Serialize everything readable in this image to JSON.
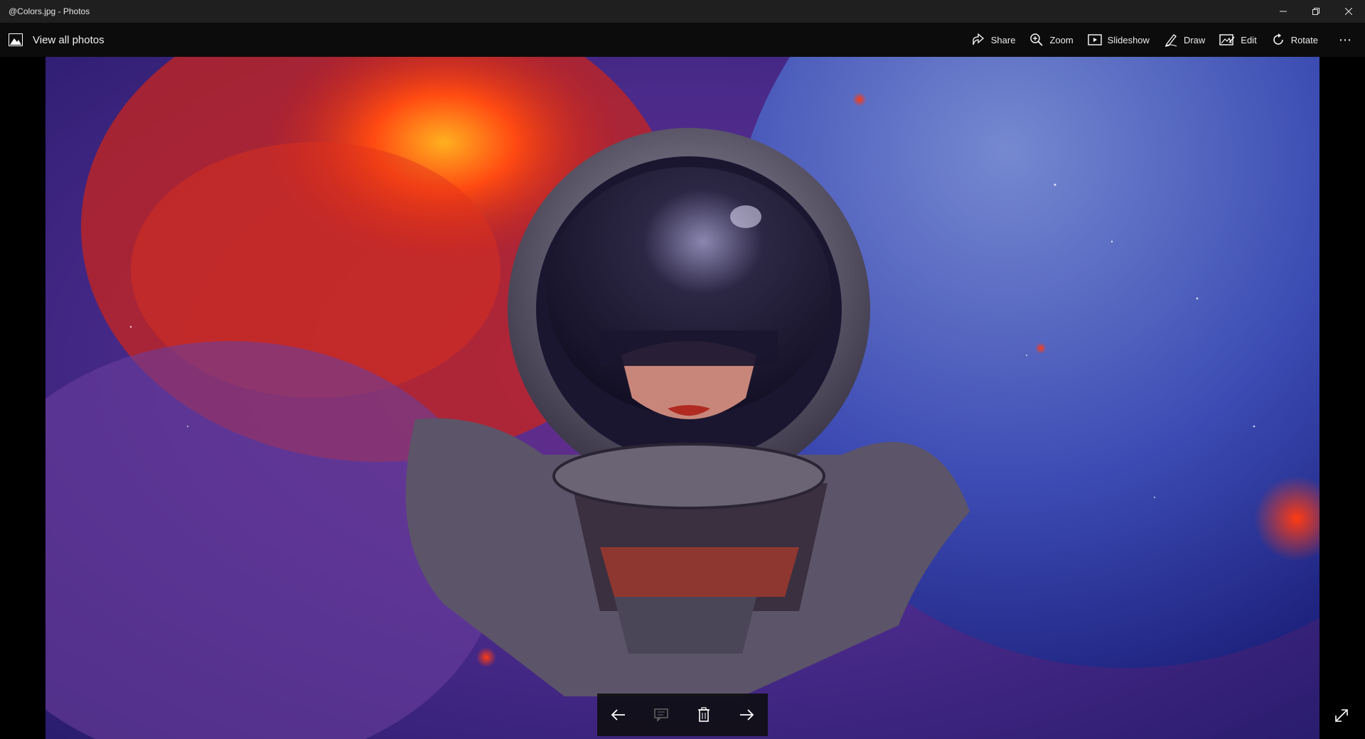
{
  "window": {
    "title": "@Colors.jpg - Photos",
    "controls": [
      "minimize",
      "restore",
      "close"
    ]
  },
  "toolbar": {
    "view_all_label": "View all photos",
    "commands": [
      {
        "label": "Share",
        "icon": "share-icon"
      },
      {
        "label": "Zoom",
        "icon": "zoom-icon"
      },
      {
        "label": "Slideshow",
        "icon": "slideshow-icon"
      },
      {
        "label": "Draw",
        "icon": "draw-icon"
      },
      {
        "label": "Edit",
        "icon": "edit-icon"
      },
      {
        "label": "Rotate",
        "icon": "rotate-icon"
      }
    ],
    "more_label": "⋯"
  },
  "navigation": {
    "buttons": [
      "previous-arrow-icon",
      "slideshow-comment-icon",
      "delete-icon",
      "next-arrow-icon"
    ]
  },
  "colors": {
    "titlebar": "#1f1f1f",
    "toolbar": "#0c0c0c",
    "accent_red": "#ff3a12",
    "space_blue": "#2a3aa8",
    "space_purple": "#5a2f8a"
  }
}
